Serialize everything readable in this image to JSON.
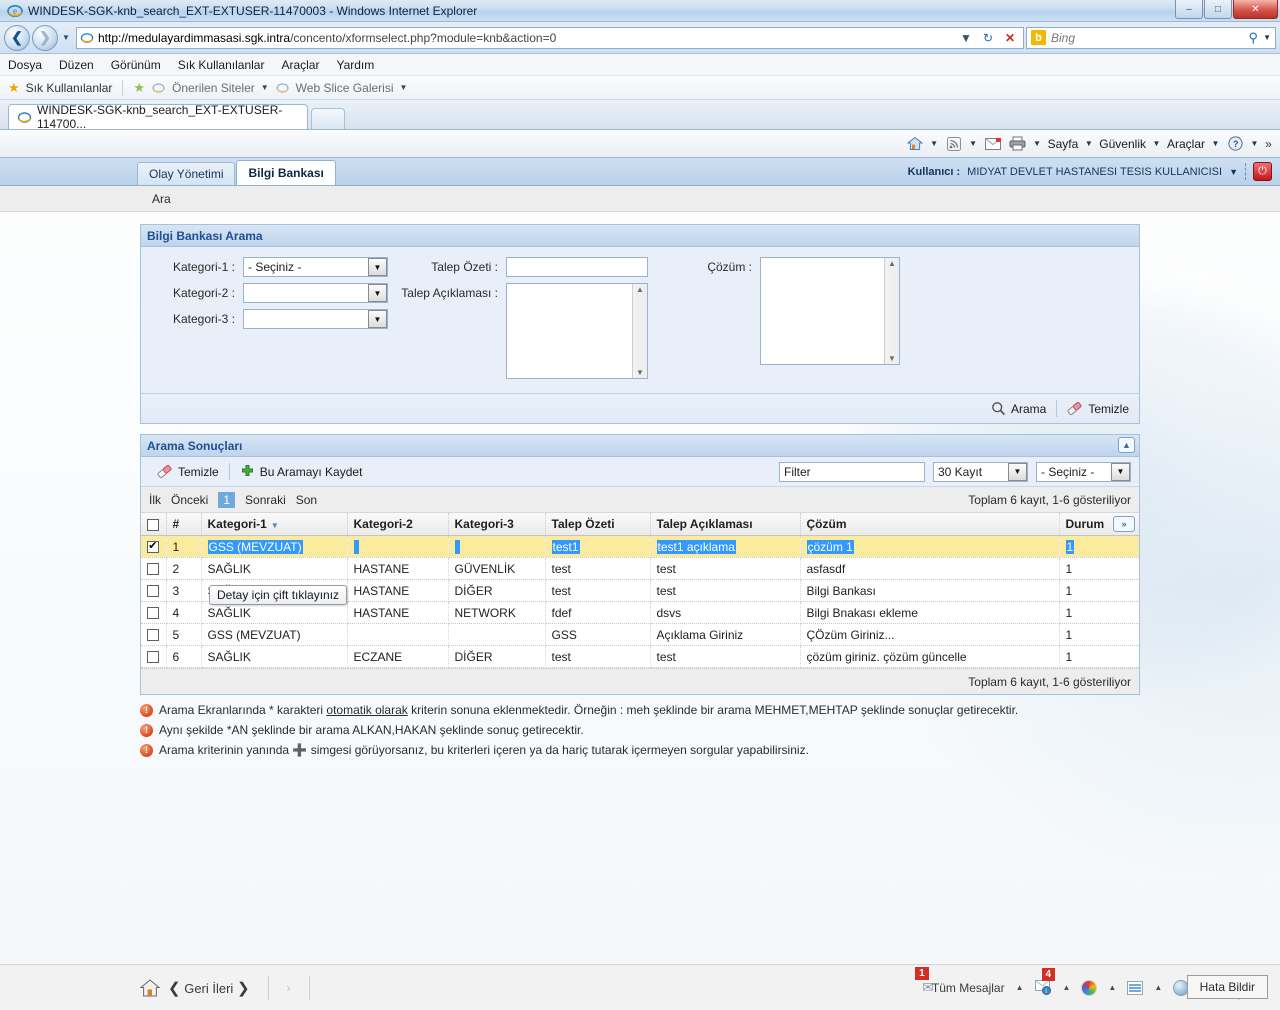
{
  "window": {
    "title": "WINDESK-SGK-knb_search_EXT-EXTUSER-11470003 - Windows Internet Explorer",
    "minimize_label": "–",
    "maximize_label": "□",
    "close_label": "✕"
  },
  "nav": {
    "back_label": "❮",
    "forward_label": "❯",
    "history_caret": "▼",
    "url_host": "http://medulayardimmasasi.sgk.intra",
    "url_path": "/concento/xformselect.php?module=knb&action=0",
    "refresh_label": "↻",
    "stop_label": "✕",
    "search_provider": "Bing",
    "search_brand_initial": "b",
    "search_go_label": "⚲",
    "search_caret": "▼"
  },
  "menubar": [
    {
      "label": "Dosya"
    },
    {
      "label": "Düzen"
    },
    {
      "label": "Görünüm"
    },
    {
      "label": "Sık Kullanılanlar"
    },
    {
      "label": "Araçlar"
    },
    {
      "label": "Yardım"
    }
  ],
  "favbar": {
    "favorites_label": "Sık Kullanılanlar",
    "suggested_sites": "Önerilen Siteler",
    "web_slice": "Web Slice Galerisi",
    "caret": "▼"
  },
  "browser_tab": {
    "label": "WINDESK-SGK-knb_search_EXT-EXTUSER-114700..."
  },
  "commandbar": {
    "home_caret": "▼",
    "feeds_caret": "▼",
    "mail_caret": "",
    "print_caret": "▼",
    "page_label": "Sayfa",
    "security_label": "Güvenlik",
    "tools_label": "Araçlar",
    "help_label": "?",
    "overflow_label": "»"
  },
  "app": {
    "tabs": [
      {
        "label": "Olay Yönetimi",
        "active": false
      },
      {
        "label": "Bilgi Bankası",
        "active": true
      }
    ],
    "user_prefix": "Kullanıcı :",
    "user_name": "MIDYAT DEVLET HASTANESI TESIS KULLANICISI",
    "user_caret": "▼",
    "logout_icon": "⏻",
    "submenu": "Ara"
  },
  "search_panel": {
    "title": "Bilgi Bankası Arama",
    "fields": {
      "kategori1_label": "Kategori-1 :",
      "kategori1_value": "- Seçiniz -",
      "kategori2_label": "Kategori-2 :",
      "kategori2_value": "",
      "kategori3_label": "Kategori-3 :",
      "kategori3_value": "",
      "talep_ozeti_label": "Talep Özeti :",
      "talep_ozeti_value": "",
      "talep_aciklamasi_label": "Talep Açıklaması :",
      "talep_aciklamasi_value": "",
      "cozum_label": "Çözüm :",
      "cozum_value": ""
    },
    "actions": {
      "search_label": "Arama",
      "clear_label": "Temizle"
    }
  },
  "results_panel": {
    "title": "Arama Sonuçları",
    "collapse_icon": "»",
    "toolbar": {
      "clear_label": "Temizle",
      "save_search_label": "Bu Aramayı Kaydet",
      "filter_placeholder": "Filter",
      "filter_value": "Filter",
      "page_size_value": "30 Kayıt",
      "saved_search_value": "- Seçiniz -"
    },
    "pager": {
      "first": "İlk",
      "prev": "Önceki",
      "current": "1",
      "next": "Sonraki",
      "last": "Son",
      "total_text": "Toplam 6 kayıt, 1-6 gösteriliyor"
    },
    "columns": [
      "#",
      "Kategori-1",
      "Kategori-2",
      "Kategori-3",
      "Talep Özeti",
      "Talep Açıklaması",
      "Çözüm",
      "Durum"
    ],
    "sort_caret": "▼",
    "expand_icon": "»",
    "rows": [
      {
        "checked": true,
        "num": "1",
        "kategori1": "GSS (MEVZUAT)",
        "kategori2": "",
        "kategori3": "",
        "talep_ozeti": "test1",
        "talep_aciklamasi": "test1 açıklama",
        "cozum": "çözüm 1",
        "durum": "1"
      },
      {
        "checked": false,
        "num": "2",
        "kategori1": "SAĞLIK",
        "kategori2": "HASTANE",
        "kategori3": "GÜVENLİK",
        "talep_ozeti": "test",
        "talep_aciklamasi": "test",
        "cozum": "asfasdf",
        "durum": "1"
      },
      {
        "checked": false,
        "num": "3",
        "kategori1": "SAĞLIK",
        "kategori2": "HASTANE",
        "kategori3": "DİĞER",
        "talep_ozeti": "test",
        "talep_aciklamasi": "test",
        "cozum": "Bilgi Bankası",
        "durum": "1"
      },
      {
        "checked": false,
        "num": "4",
        "kategori1": "SAĞLIK",
        "kategori2": "HASTANE",
        "kategori3": "NETWORK",
        "talep_ozeti": "fdef",
        "talep_aciklamasi": "dsvs",
        "cozum": "Bilgi Bnakası ekleme",
        "durum": "1"
      },
      {
        "checked": false,
        "num": "5",
        "kategori1": "GSS (MEVZUAT)",
        "kategori2": "",
        "kategori3": "",
        "talep_ozeti": "GSS",
        "talep_aciklamasi": "Açıklama Giriniz",
        "cozum": "ÇÖzüm Giriniz...",
        "durum": "1"
      },
      {
        "checked": false,
        "num": "6",
        "kategori1": "SAĞLIK",
        "kategori2": "ECZANE",
        "kategori3": "DİĞER",
        "talep_ozeti": "test",
        "talep_aciklamasi": "test",
        "cozum": "çözüm giriniz. çözüm güncelle",
        "durum": "1"
      }
    ],
    "footer_total": "Toplam 6 kayıt, 1-6 gösteriliyor"
  },
  "tooltip": {
    "text": "Detay için çift tıklayınız"
  },
  "notes": [
    {
      "pre": "Arama Ekranlarında * karakteri ",
      "underlined": "otomatik olarak",
      "post": " kriterin sonuna eklenmektedir. Örneğin : meh şeklinde bir arama MEHMET,MEHTAP şeklinde sonuçlar getirecektir."
    },
    {
      "pre": "Aynı şekilde *AN şeklinde bir arama ALKAN,HAKAN şeklinde sonuç getirecektir.",
      "underlined": "",
      "post": ""
    },
    {
      "pre": "Arama kriterinin yanında ",
      "underlined": "",
      "post": " simgesi görüyorsanız, bu kriterleri içeren ya da hariç tutarak içermeyen sorgular yapabilirsiniz."
    }
  ],
  "taskbar": {
    "nav_back": "❮",
    "nav_text": "Geri İleri",
    "nav_fwd": "❯",
    "chevron": "›",
    "messages_label": "Tüm Mesajlar",
    "messages_badge": "1",
    "notify_badge": "4",
    "tray_caret": "▲",
    "power_icon": "⏻",
    "overflow_icon": "»",
    "report_error_label": "Hata Bildir"
  },
  "colors": {
    "accent": "#1d4f91",
    "panel_bg": "#e9eff8",
    "selected_row": "#faeb9e",
    "highlight": "#3399ff",
    "pager_active": "#6fa8dc"
  }
}
